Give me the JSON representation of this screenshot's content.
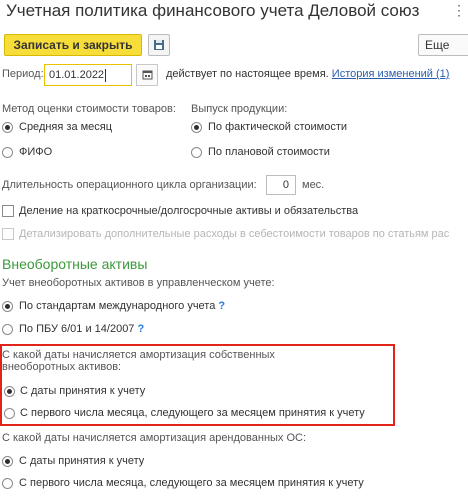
{
  "header": {
    "title": "Учетная политика финансового учета Деловой союз",
    "more_icon": "more-vertical-icon"
  },
  "toolbar": {
    "save_close_label": "Записать и закрыть",
    "save_icon": "save-disk-icon",
    "more_label": "Еще"
  },
  "period": {
    "label": "Период:",
    "value": "01.01.2022",
    "calendar_icon": "calendar-icon",
    "status_text": "действует по настоящее время.",
    "history_link": "История изменений (1)"
  },
  "valuation": {
    "label": "Метод оценки стоимости товаров:",
    "options": [
      {
        "label": "Средняя за месяц",
        "selected": true
      },
      {
        "label": "ФИФО",
        "selected": false
      }
    ]
  },
  "production": {
    "label": "Выпуск продукции:",
    "options": [
      {
        "label": "По фактической стоимости",
        "selected": true
      },
      {
        "label": "По плановой стоимости",
        "selected": false
      }
    ]
  },
  "cycle": {
    "label": "Длительность операционного цикла организации:",
    "value": "0",
    "unit": "мес."
  },
  "checkboxes": [
    {
      "label": "Деление на краткосрочные/долгосрочные активы и обязательства",
      "checked": false,
      "enabled": true
    },
    {
      "label": "Детализировать дополнительные расходы в себестоимости товаров по статьям рас",
      "checked": false,
      "enabled": false
    }
  ],
  "noncurrent": {
    "section_title": "Внеоборотные активы",
    "mgmt_label": "Учет внеоборотных активов в управленческом учете:",
    "mgmt_options": [
      {
        "label": "По стандартам международного учета",
        "selected": true,
        "help": "?"
      },
      {
        "label": "По ПБУ 6/01 и 14/2007",
        "selected": false,
        "help": "?"
      }
    ],
    "own_label_line1": "С какой даты начисляется амортизация собственных",
    "own_label_line2": "внеоборотных активов:",
    "own_options": [
      {
        "label": "С даты принятия к учету",
        "selected": true
      },
      {
        "label": "С первого числа месяца, следующего за месяцем принятия к учету",
        "selected": false
      }
    ],
    "lease_label": "С какой даты начисляется амортизация арендованных ОС:",
    "lease_options": [
      {
        "label": "С даты принятия к учету",
        "selected": true
      },
      {
        "label": "С первого числа месяца, следующего за месяцем принятия к учету",
        "selected": false
      }
    ]
  },
  "colors": {
    "accent_button": "#f7dd3a",
    "section_title": "#3a9a3a",
    "link": "#2a5db0",
    "help": "#2a7be4",
    "highlight_border": "#e2231a"
  }
}
